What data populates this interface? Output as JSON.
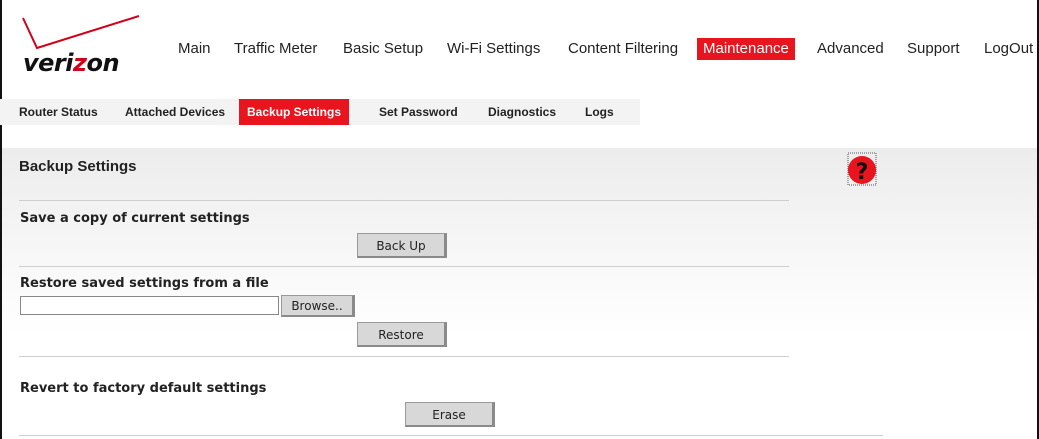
{
  "brand": {
    "logo_text_a": "veri",
    "logo_text_b": "z",
    "logo_text_c": "on",
    "accent": "#e8141e"
  },
  "topnav": {
    "items": [
      "Main",
      "Traffic Meter",
      "Basic Setup",
      "Wi-Fi Settings",
      "Content Filtering",
      "Maintenance",
      "Advanced",
      "Support",
      "LogOut"
    ],
    "active": "Maintenance"
  },
  "subnav": {
    "items": [
      "Router Status",
      "Attached Devices",
      "Backup Settings",
      "Set Password",
      "Diagnostics",
      "Logs"
    ],
    "active": "Backup Settings"
  },
  "page": {
    "title": "Backup Settings",
    "help_icon": "question-mark-icon",
    "save": {
      "label": "Save a copy of current settings",
      "button": "Back Up"
    },
    "restore": {
      "label": "Restore saved settings from a file",
      "file_value": "",
      "browse_button": "Browse..",
      "button": "Restore"
    },
    "factory": {
      "label": "Revert to factory default settings",
      "button": "Erase"
    }
  }
}
